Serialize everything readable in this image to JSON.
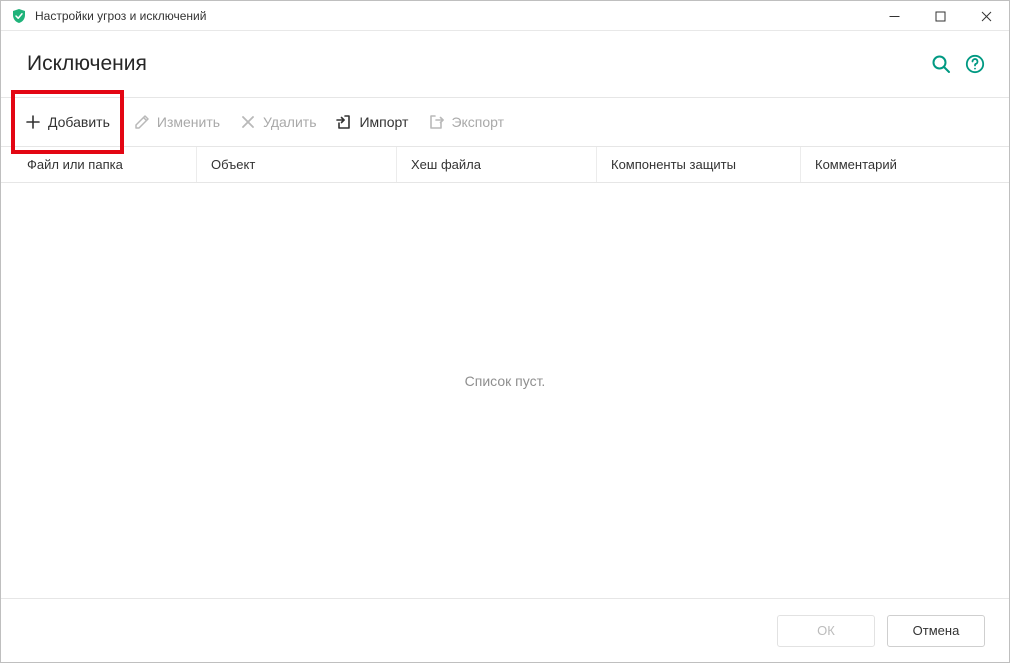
{
  "window": {
    "title": "Настройки угроз и исключений"
  },
  "header": {
    "title": "Исключения"
  },
  "toolbar": {
    "add": "Добавить",
    "edit": "Изменить",
    "delete": "Удалить",
    "import": "Импорт",
    "export": "Экспорт"
  },
  "columns": {
    "file_or_folder": "Файл или папка",
    "object": "Объект",
    "file_hash": "Хеш файла",
    "protection_components": "Компоненты защиты",
    "comment": "Комментарий"
  },
  "empty_state": "Список пуст.",
  "footer": {
    "ok": "ОК",
    "cancel": "Отмена"
  }
}
